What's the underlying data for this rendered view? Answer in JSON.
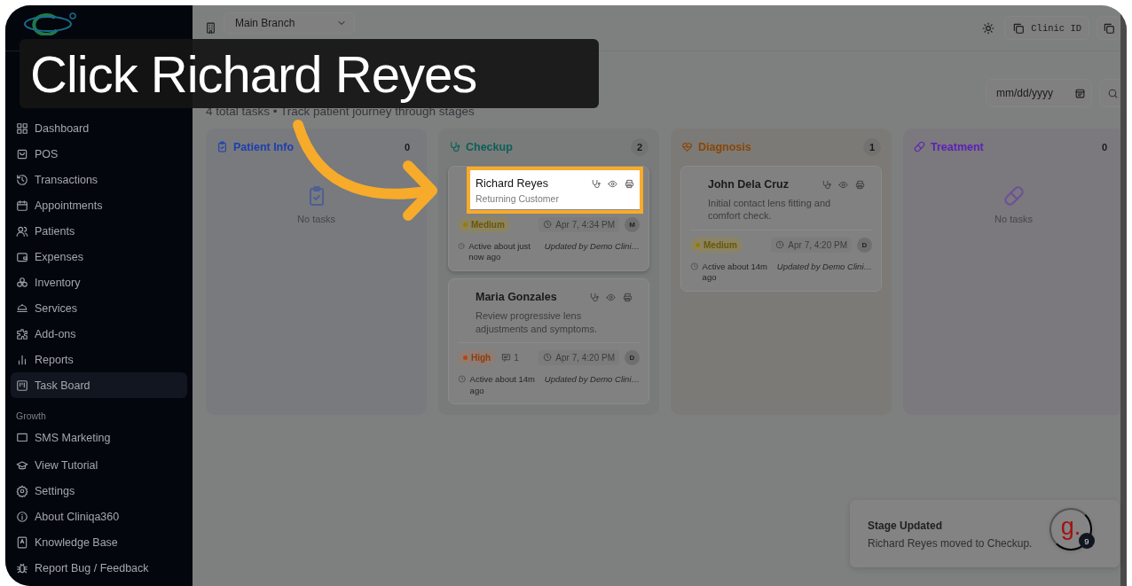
{
  "caption": {
    "text": "Click Richard Reyes"
  },
  "sidebar": {
    "main": [
      {
        "label": "Dashboard",
        "selected": false
      },
      {
        "label": "POS",
        "selected": false
      },
      {
        "label": "Transactions",
        "selected": false
      },
      {
        "label": "Appointments",
        "selected": false
      },
      {
        "label": "Patients",
        "selected": false
      },
      {
        "label": "Expenses",
        "selected": false
      },
      {
        "label": "Inventory",
        "selected": false
      },
      {
        "label": "Services",
        "selected": false
      },
      {
        "label": "Add-ons",
        "selected": false
      },
      {
        "label": "Reports",
        "selected": false
      },
      {
        "label": "Task Board",
        "selected": true
      }
    ],
    "section_label": "Growth",
    "growth": [
      {
        "label": "SMS Marketing",
        "selected": false
      }
    ],
    "footer": [
      "View Tutorial",
      "Settings",
      "About Cliniqa360",
      "Knowledge Base",
      "Report Bug / Feedback"
    ]
  },
  "topbar": {
    "branch": "Main Branch",
    "clinic_id": "Clinic ID"
  },
  "board": {
    "subtitle": "4 total tasks • Track patient journey through stages",
    "date_placeholder": "mm/dd/yyyy",
    "columns": [
      {
        "title": "Patient Info",
        "count": "0",
        "color": "#1d3fae",
        "empty_text": "No tasks"
      },
      {
        "title": "Checkup",
        "count": "2",
        "color": "#0c5f58",
        "tasks": [
          {
            "name": "Richard Reyes",
            "description": "Returning Customer",
            "highlighted": true,
            "priority": {
              "label": "Medium",
              "kind": "medium"
            },
            "time": "Apr 7, 4:34 PM",
            "assignee": "M",
            "activity": "Active about just now ago",
            "updated_by": "Updated by Demo Clini…"
          },
          {
            "name": "Maria Gonzales",
            "description": "Review progressive lens adjustments and symptoms.",
            "highlighted": false,
            "priority": {
              "label": "High",
              "kind": "high"
            },
            "comments": "1",
            "time": "Apr 7, 4:20 PM",
            "assignee": "D",
            "activity": "Active about 14m ago",
            "updated_by": "Updated by Demo Clini…"
          }
        ]
      },
      {
        "title": "Diagnosis",
        "count": "1",
        "color": "#8a4604",
        "tasks": [
          {
            "name": "John Dela Cruz",
            "description": "Initial contact lens fitting and comfort check.",
            "highlighted": false,
            "priority": {
              "label": "Medium",
              "kind": "medium"
            },
            "time": "Apr 7, 4:20 PM",
            "assignee": "D",
            "activity": "Active about 14m ago",
            "updated_by": "Updated by Demo Clini…"
          }
        ]
      },
      {
        "title": "Treatment",
        "count": "0",
        "color": "#5b21b6",
        "empty_text": "No tasks"
      }
    ]
  },
  "toast": {
    "title": "Stage Updated",
    "message": "Richard Reyes moved to Checkup.",
    "avatar": "g.",
    "badge": "9"
  }
}
